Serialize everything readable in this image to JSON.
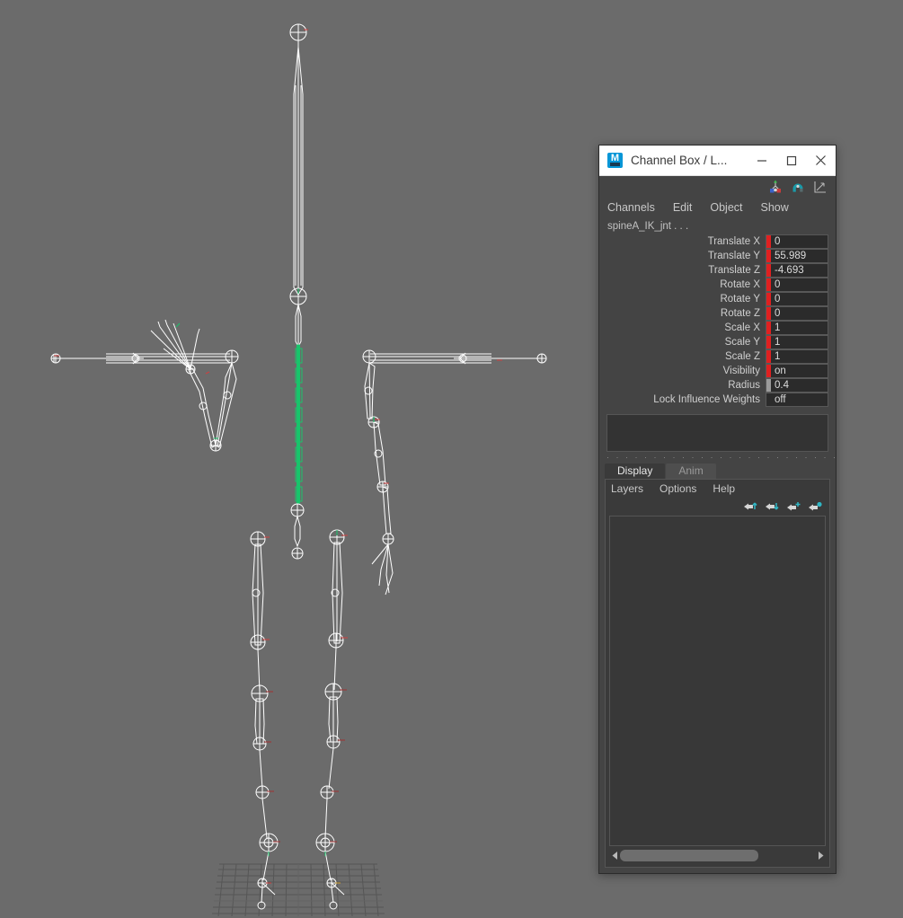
{
  "app": {
    "background_color": "#6b6b6b",
    "panel_color": "#444444"
  },
  "window": {
    "title": "Channel Box / L...",
    "icon": "maya-logo-icon",
    "minimize_label": "Minimize",
    "maximize_label": "Maximize",
    "close_label": "Close"
  },
  "channel_box": {
    "toolbar_icons": [
      {
        "name": "manipulator-axis-icon",
        "label": "Show Manipulator"
      },
      {
        "name": "magnet-snap-icon",
        "label": "Attribute Editor"
      },
      {
        "name": "graph-line-icon",
        "label": "Graph Editor"
      }
    ],
    "menus": [
      "Channels",
      "Edit",
      "Object",
      "Show"
    ],
    "object_name": "spineA_IK_jnt . . .",
    "key_color": "#e02020",
    "attributes": [
      {
        "label": "Translate X",
        "value": "0",
        "key": "red"
      },
      {
        "label": "Translate Y",
        "value": "55.989",
        "key": "red"
      },
      {
        "label": "Translate Z",
        "value": "-4.693",
        "key": "red"
      },
      {
        "label": "Rotate X",
        "value": "0",
        "key": "red"
      },
      {
        "label": "Rotate Y",
        "value": "0",
        "key": "red"
      },
      {
        "label": "Rotate Z",
        "value": "0",
        "key": "red"
      },
      {
        "label": "Scale X",
        "value": "1",
        "key": "red"
      },
      {
        "label": "Scale Y",
        "value": "1",
        "key": "red"
      },
      {
        "label": "Scale Z",
        "value": "1",
        "key": "red"
      },
      {
        "label": "Visibility",
        "value": "on",
        "key": "red"
      },
      {
        "label": "Radius",
        "value": "0.4",
        "key": "grey"
      },
      {
        "label": "Lock Influence Weights",
        "value": "off",
        "key": "none"
      }
    ],
    "separator_dots": "· · · · · · · · · · · · · · · · · · · · · · · · · · · ·"
  },
  "layer_editor": {
    "tabs": [
      {
        "label": "Display",
        "active": true
      },
      {
        "label": "Anim",
        "active": false
      }
    ],
    "menus": [
      "Layers",
      "Options",
      "Help"
    ],
    "icons": [
      {
        "name": "layer-move-up-icon",
        "label": "Move Layer Up"
      },
      {
        "name": "layer-move-down-icon",
        "label": "Move Layer Down"
      },
      {
        "name": "layer-new-icon",
        "label": "Create New Layer"
      },
      {
        "name": "layer-new-from-selected-icon",
        "label": "Create Layer From Selected"
      }
    ],
    "accent_color": "#2fb6c4",
    "scroll_left_label": "Scroll Left",
    "scroll_right_label": "Scroll Right"
  },
  "viewport": {
    "label": "3d-skeleton-viewport",
    "selection_color": "#19c46b",
    "joint_color": "#ffffff",
    "grid_color": "#5a5a5a",
    "selected_chain": "spine"
  }
}
